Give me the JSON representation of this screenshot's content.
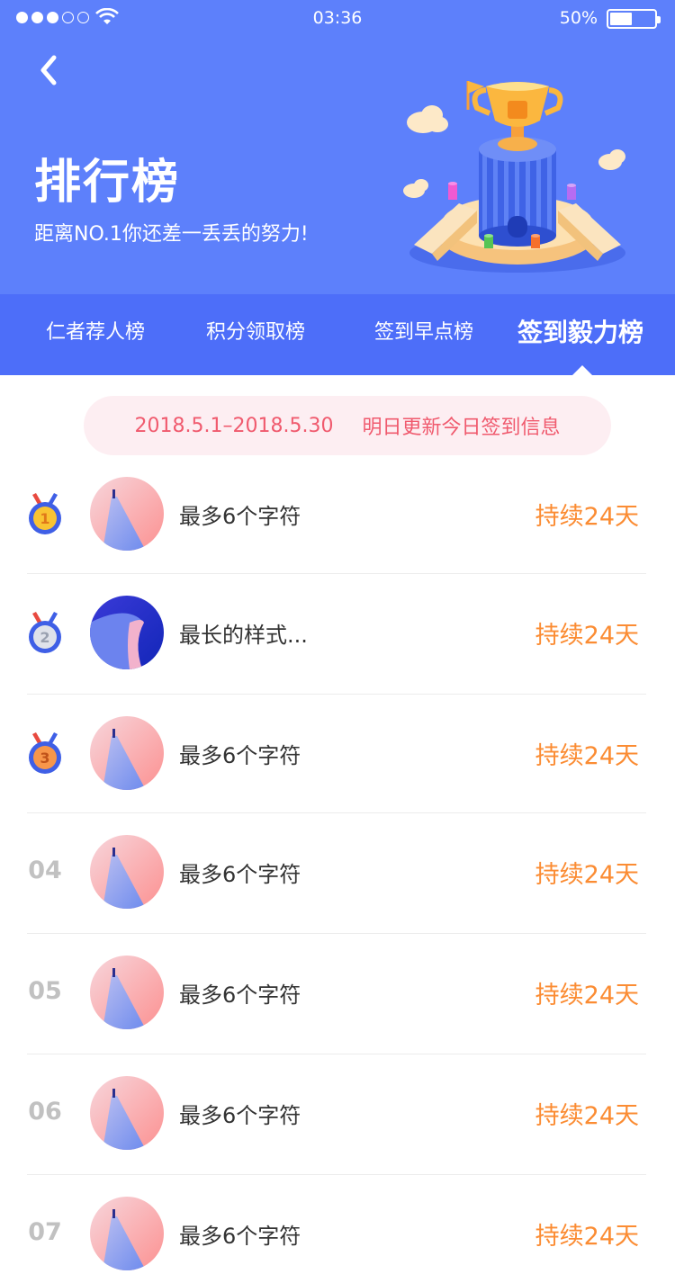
{
  "status_bar": {
    "time": "03:36",
    "battery": "50%"
  },
  "header": {
    "title": "排行榜",
    "subtitle": "距离NO.1你还差一丢丢的努力!",
    "colors": {
      "background": "#5d80fb",
      "tabs": "#4d6ef9"
    }
  },
  "tabs": [
    {
      "label": "仁者荐人榜",
      "active": false
    },
    {
      "label": "积分领取榜",
      "active": false
    },
    {
      "label": "签到早点榜",
      "active": false
    },
    {
      "label": "签到毅力榜",
      "active": true
    }
  ],
  "notice": {
    "date_range": "2018.5.1–2018.5.30",
    "message": "明日更新今日签到信息"
  },
  "rows": [
    {
      "rank": "1",
      "medal": "gold-medal-icon",
      "name": "最多6个字符",
      "days": "持续24天",
      "avatar": "pink"
    },
    {
      "rank": "2",
      "medal": "silver-medal-icon",
      "name": "最长的样式...",
      "days": "持续24天",
      "avatar": "blue"
    },
    {
      "rank": "3",
      "medal": "bronze-medal-icon",
      "name": "最多6个字符",
      "days": "持续24天",
      "avatar": "pink"
    },
    {
      "rank": "04",
      "name": "最多6个字符",
      "days": "持续24天",
      "avatar": "pink"
    },
    {
      "rank": "05",
      "name": "最多6个字符",
      "days": "持续24天",
      "avatar": "pink"
    },
    {
      "rank": "06",
      "name": "最多6个字符",
      "days": "持续24天",
      "avatar": "pink"
    },
    {
      "rank": "07",
      "name": "最多6个字符",
      "days": "持续24天",
      "avatar": "pink"
    }
  ],
  "colors": {
    "days_text": "#fb8c33",
    "notice_text": "#f05a6e",
    "rank_text": "#c1c1c1"
  }
}
